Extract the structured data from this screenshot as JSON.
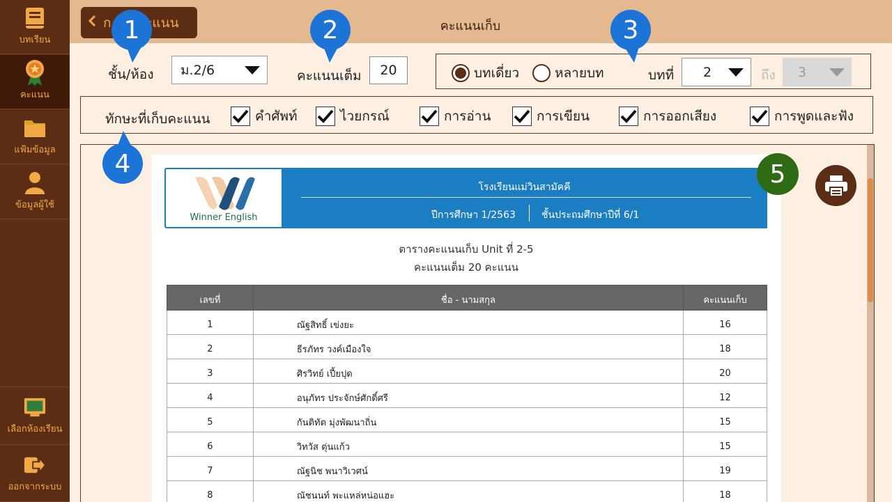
{
  "sidebar": {
    "items": [
      {
        "label": "บทเรียน",
        "icon": "book-icon"
      },
      {
        "label": "คะแนน",
        "icon": "medal-icon"
      },
      {
        "label": "แฟ้มข้อมูล",
        "icon": "folder-icon"
      },
      {
        "label": "ข้อมูลผู้ใช้",
        "icon": "user-icon"
      }
    ],
    "bottom": [
      {
        "label": "เลือกห้องเรียน",
        "icon": "classroom-board-icon"
      },
      {
        "label": "ออกจากระบบ",
        "icon": "logout-icon"
      }
    ]
  },
  "header": {
    "back_label": "ก",
    "back_label_tail": "คะแนน",
    "title": "คะแนนเก็บ"
  },
  "filters": {
    "class_label": "ชั้น/ห้อง",
    "class_value": "ม.2/6",
    "full_score_label": "คะแนนเต็ม",
    "full_score_value": "20",
    "radio_single": "บทเดี่ยว",
    "radio_multi": "หลายบท",
    "unit_label": "บทที่",
    "unit_value": "2",
    "to_label": "ถึง",
    "to_value": "3"
  },
  "skills": {
    "label": "ทักษะที่เก็บคะแนน",
    "items": [
      "คำศัพท์",
      "ไวยกรณ์",
      "การอ่าน",
      "การเขียน",
      "การออกเสียง",
      "การพูดและฟัง"
    ]
  },
  "report": {
    "logo_text": "Winner English",
    "school": "โรงเรียนแม่วินสามัคคี",
    "year": "ปีการศึกษา 1/2563",
    "grade": "ชั้นประถมศึกษาปีที่ 6/1",
    "title1": "ตารางคะแนนเก็บ Unit ที่ 2-5",
    "title2": "คะแนนเต็ม 20 คะแนน",
    "columns": [
      "เลขที่",
      "ชื่อ - นามสกุล",
      "คะแนนเก็บ"
    ],
    "rows": [
      [
        "1",
        "ณัฐสิทธิ์ เข่งยะ",
        "16"
      ],
      [
        "2",
        "ธีรภัทร วงค์เมืองใจ",
        "18"
      ],
      [
        "3",
        "ศิรวิทย์ เปี้ยปุด",
        "20"
      ],
      [
        "4",
        "อนุภัทร ประจักษ์ศักดิ์ศรี",
        "12"
      ],
      [
        "5",
        "กันติทัต มุ่งพัฒนาถิ่น",
        "15"
      ],
      [
        "6",
        "วิทวัส ตุ่นแก้ว",
        "15"
      ],
      [
        "7",
        "ณัฐนิช พนาวิเวศน์",
        "19"
      ],
      [
        "8",
        "ณัชนนท์ พะแหล่หน่อแฮะ",
        "18"
      ]
    ]
  },
  "callouts": [
    "1",
    "2",
    "3",
    "4",
    "5"
  ],
  "colors": {
    "sidebar": "#5a2d14",
    "accent": "#f3a846",
    "header": "#e5b98f",
    "background": "#fdf0e3",
    "report_band": "#1c7ec2",
    "callout_blue": "#1b74d6",
    "callout_green": "#2f6b14"
  }
}
